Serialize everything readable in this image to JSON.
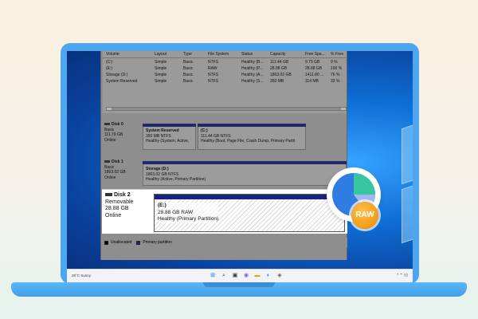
{
  "volume_table": {
    "headers": [
      "Volume",
      "Layout",
      "Type",
      "File System",
      "Status",
      "Capacity",
      "Free Spa...",
      "% Free"
    ],
    "rows": [
      [
        "(C:)",
        "Simple",
        "Basic",
        "NTFS",
        "Healthy (B...",
        "111.44 GB",
        "9.75 GB",
        "9 %"
      ],
      [
        "(E:)",
        "Simple",
        "Basic",
        "RAW",
        "Healthy (P...",
        "28.88 GB",
        "28.88 GB",
        "100 %"
      ],
      [
        "Storage (D:)",
        "Simple",
        "Basic",
        "NTFS",
        "Healthy (A...",
        "1863.02 GB",
        "1411.80 ...",
        "76 %"
      ],
      [
        "System Reserved",
        "Simple",
        "Basic",
        "NTFS",
        "Healthy (S...",
        "350 MB",
        "114 MB",
        "33 %"
      ]
    ]
  },
  "disks": [
    {
      "name": "Disk 0",
      "type": "Basic",
      "size": "111.79 GB",
      "status": "Online",
      "partitions": [
        {
          "name": "System Reserved",
          "size_fs": "350 MB NTFS",
          "status": "Healthy (System, Active,"
        },
        {
          "name": "(C:)",
          "size_fs": "111.44 GB NTFS",
          "status": "Healthy (Boot, Page File, Crash Dump, Primary Partit"
        }
      ]
    },
    {
      "name": "Disk 1",
      "type": "Basic",
      "size": "1863.02 GB",
      "status": "Online",
      "partitions": [
        {
          "name": "Storage  (D:)",
          "size_fs": "1863.02 GB NTFS",
          "status": "Healthy (Active, Primary Partition)"
        }
      ]
    },
    {
      "name": "Disk 2",
      "type": "Removable",
      "size": "28.88 GB",
      "status": "Online",
      "partitions": [
        {
          "name": "(E:)",
          "size_fs": "28.88 GB RAW",
          "status": "Healthy (Primary Partition)"
        }
      ]
    }
  ],
  "legend": {
    "unallocated": "Unallocated",
    "primary": "Primary partition"
  },
  "taskbar": {
    "weather": "26°C  Sunny"
  },
  "badge": {
    "label": "RAW"
  },
  "colors": {
    "partition_bar": "#1d2b6e",
    "accent": "#f39a14"
  }
}
